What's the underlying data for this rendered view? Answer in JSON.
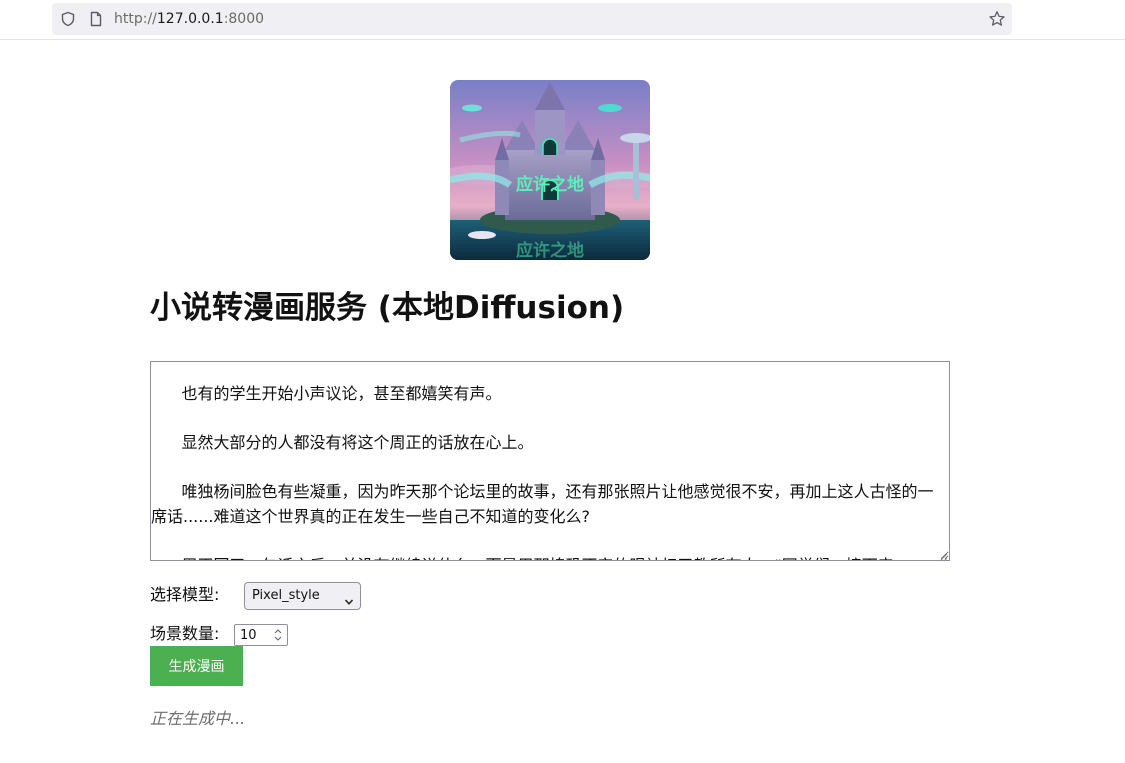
{
  "browser": {
    "url_scheme": "http://",
    "url_host": "127.0.0.1",
    "url_port": ":8000"
  },
  "logo": {
    "text_main": "应许之地",
    "text_reflection": "应许之地"
  },
  "page": {
    "title": "小说转漫画服务 (本地Diffusion)",
    "novel_text": "      也有的学生开始小声议论，甚至都嬉笑有声。\n\n      显然大部分的人都没有将这个周正的话放在心上。\n\n      唯独杨间脸色有些凝重，因为昨天那个论坛里的故事，还有那张照片让他感觉很不安，再加上这人古怪的一席话......难道这个世界真的正在发生一些自己不知道的变化么?\n\n      周正回了一句话之后，并没有继续说什么，而是用那惶恐不安的眼神扫了教所有人，“同学们，接下来",
    "model_label": "选择模型:",
    "model_selected": "Pixel_style",
    "scene_label": "场景数量:",
    "scene_count": "10",
    "generate_label": "生成漫画",
    "status": "正在生成中..."
  },
  "colors": {
    "button_bg": "#4caf50",
    "button_text": "#ffffff",
    "status_text": "#6e6e6e"
  },
  "icons": [
    "shield-icon",
    "page-icon",
    "star-icon",
    "chevron-down-icon",
    "spinner-arrows-icon",
    "resize-grip-icon"
  ]
}
